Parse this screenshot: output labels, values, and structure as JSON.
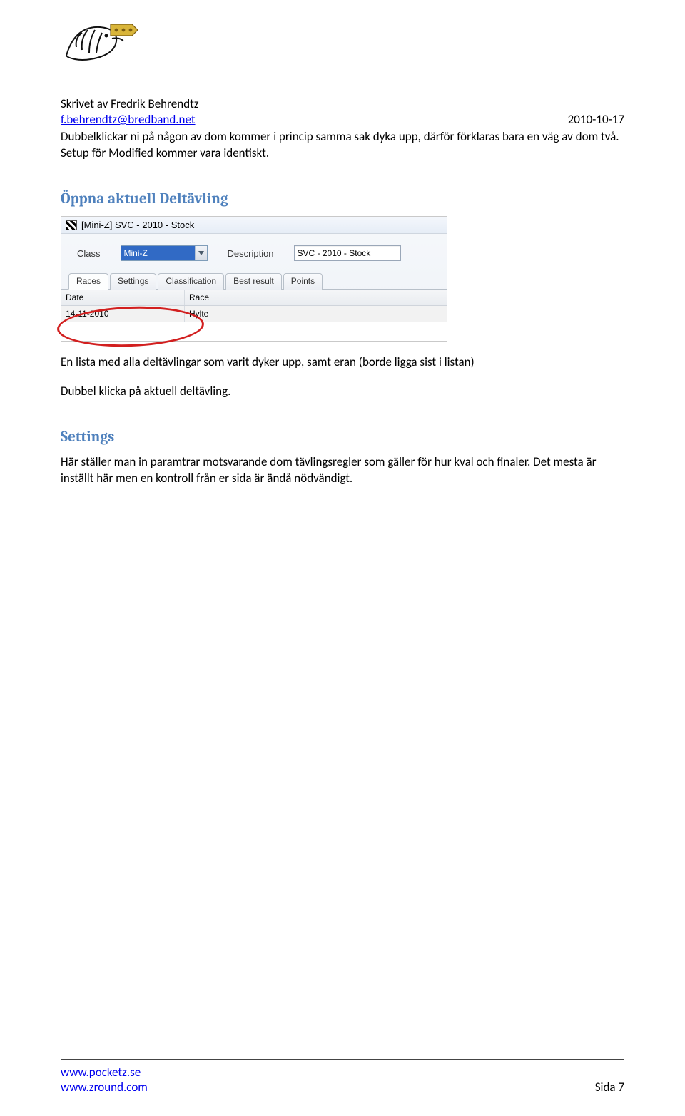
{
  "header": {
    "author_line": "Skrivet av Fredrik Behrendtz",
    "email": "f.behrendtz@bredband.net",
    "date": "2010-10-17"
  },
  "intro": {
    "p1": "Dubbelklickar ni på någon av dom kommer i princip samma sak dyka upp, därför förklaras bara en väg av dom två. Setup för Modified kommer vara identiskt."
  },
  "section1": {
    "heading": "Öppna aktuell Deltävling",
    "p_after_img": "En lista med alla deltävlingar som varit dyker upp, samt eran (borde ligga sist i listan)",
    "p2": "Dubbel klicka på aktuell deltävling."
  },
  "section2": {
    "heading": "Settings",
    "p1": "Här ställer man in paramtrar motsvarande dom tävlingsregler som gäller för hur kval och finaler. Det mesta är inställt här men en kontroll från er sida är ändå nödvändigt."
  },
  "screenshot": {
    "title": "[Mini-Z] SVC - 2010 - Stock",
    "class_label": "Class",
    "class_value": "Mini-Z",
    "desc_label": "Description",
    "desc_value": "SVC - 2010 - Stock",
    "tabs": [
      "Races",
      "Settings",
      "Classification",
      "Best result",
      "Points"
    ],
    "grid": {
      "col_date": "Date",
      "col_race": "Race",
      "row_date": "14-11-2010",
      "row_race": "Hylte"
    }
  },
  "footer": {
    "link1": "www.pocketz.se",
    "link2": "www.zround.com",
    "page": "Sida 7"
  }
}
